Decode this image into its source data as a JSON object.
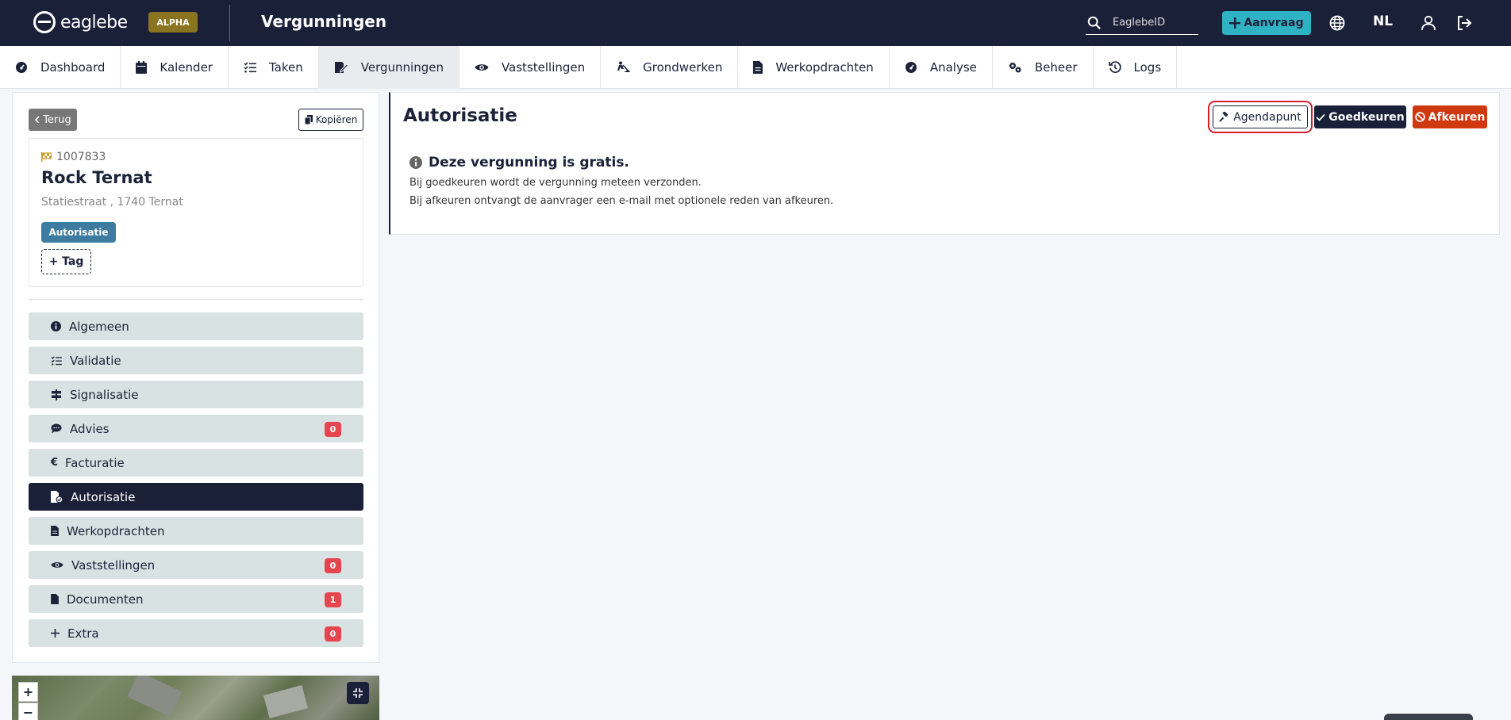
{
  "header": {
    "logo_text": "eaglebe",
    "badge": "ALPHA",
    "title": "Vergunningen",
    "search_placeholder": "EaglebeID",
    "aanvraag_label": "Aanvraag",
    "language": "NL"
  },
  "nav": {
    "items": [
      {
        "label": "Dashboard",
        "icon": "gauge-icon"
      },
      {
        "label": "Kalender",
        "icon": "calendar-icon"
      },
      {
        "label": "Taken",
        "icon": "task-list-icon"
      },
      {
        "label": "Vergunningen",
        "icon": "permit-edit-icon",
        "active": true
      },
      {
        "label": "Vaststellingen",
        "icon": "eye-icon"
      },
      {
        "label": "Grondwerken",
        "icon": "digging-icon"
      },
      {
        "label": "Werkopdrachten",
        "icon": "file-icon"
      },
      {
        "label": "Analyse",
        "icon": "gauge-icon"
      },
      {
        "label": "Beheer",
        "icon": "gears-icon"
      },
      {
        "label": "Logs",
        "icon": "history-icon"
      }
    ]
  },
  "sidebar": {
    "back_label": "Terug",
    "copy_label": "Kopiëren",
    "permit": {
      "id": "1007833",
      "name": "Rock Ternat",
      "address": "Statiestraat , 1740 Ternat",
      "tag": "Autorisatie",
      "add_tag_label": "+ Tag"
    },
    "menu": [
      {
        "label": "Algemeen",
        "icon": "info-circle-icon"
      },
      {
        "label": "Validatie",
        "icon": "task-list-icon"
      },
      {
        "label": "Signalisatie",
        "icon": "signpost-icon"
      },
      {
        "label": "Advies",
        "icon": "comments-icon",
        "badge": "0"
      },
      {
        "label": "Facturatie",
        "icon": "euro-icon"
      },
      {
        "label": "Autorisatie",
        "icon": "file-signature-icon",
        "active": true
      },
      {
        "label": "Werkopdrachten",
        "icon": "file-icon"
      },
      {
        "label": "Vaststellingen",
        "icon": "eye-icon",
        "badge": "0"
      },
      {
        "label": "Documenten",
        "icon": "file-icon",
        "badge": "1"
      },
      {
        "label": "Extra",
        "icon": "plus-icon",
        "badge": "0"
      }
    ]
  },
  "map": {
    "zoom_in": "+",
    "zoom_out": "−"
  },
  "main": {
    "title": "Autorisatie",
    "agendapunt_label": "Agendapunt",
    "goedkeuren_label": "Goedkeuren",
    "afkeuren_label": "Afkeuren",
    "info_title": "Deze vergunning is gratis.",
    "info_line1": "Bij goedkeuren wordt de vergunning meteen verzonden.",
    "info_line2": "Bij afkeuren ontvangt de aanvrager een e-mail met optionele reden van afkeuren."
  },
  "colors": {
    "navy": "#1b2039",
    "teal": "#2fb3c4",
    "danger": "#d0380f",
    "badge_red": "#e6444e",
    "tag_blue": "#3e7ba0",
    "alpha_gold": "#8b7420"
  }
}
